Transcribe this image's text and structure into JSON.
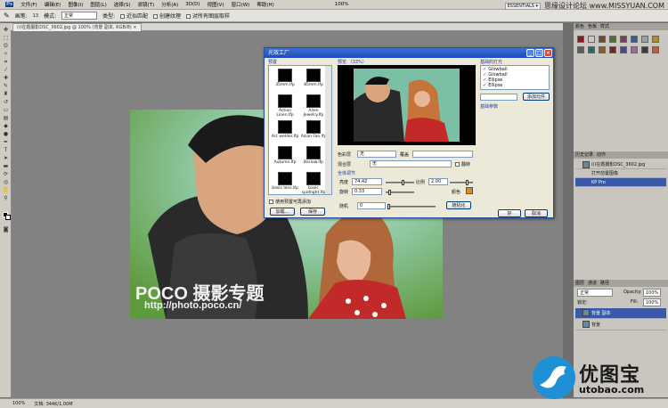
{
  "app": {
    "menu": [
      "文件(F)",
      "编辑(E)",
      "图像(I)",
      "图层(L)",
      "选择(S)",
      "滤镜(T)",
      "分析(A)",
      "3D(D)",
      "视图(V)",
      "窗口(W)",
      "帮助(H)"
    ],
    "zoom": "100%",
    "workspace": "ESSENTIALS ▾",
    "brand": "思缘设计论坛 www.MISSYUAN.COM"
  },
  "options": {
    "brush_label": "画笔:",
    "brush_size": "13",
    "mode_label": "模式:",
    "mode_value": "正常",
    "type_label": "类型:",
    "opt1": "近似匹配",
    "opt2": "创建纹理",
    "opt3": "对所有图层取样"
  },
  "document": {
    "tab_title": "(i)在婚摄影DSC_3602.jpg @ 100% (背景 副本, RGB/8) ×",
    "watermark_main": "POCO 摄影专题",
    "watermark_url": "http://photo.poco.cn/"
  },
  "status": {
    "zoom": "100%",
    "doc": "文档: 344K/1.00M"
  },
  "dialog": {
    "title": "光效工厂",
    "presets_label": "预置",
    "preview_label": "预览 （33%）",
    "elements_label": "基础的灯光",
    "presets": [
      [
        "35mm.lfp",
        "85mm.lfp"
      ],
      [
        "Action Linen.lfp",
        "Alien Jewelry.lfp"
      ],
      [
        "Arc welder.lfp",
        "Asian Fan.lfp"
      ],
      [
        "Autumn.lfp",
        "Barlow.lfp"
      ],
      [
        "basic lens.lfp",
        "basic spotlight.lfp"
      ]
    ],
    "preset_checkbox": "使用预置可再添加",
    "load_btn": "加载...",
    "save_btn": "保存",
    "color_mode_label": "色彩层",
    "color_mode_value": "无",
    "overlay_label": "覆盖",
    "blend_label": "混合层",
    "blend_value": "无",
    "flip_label": "翻转",
    "global_label": "全体调节",
    "brightness_label": "亮度",
    "brightness_value": "74.42",
    "scale_label": "比例",
    "scale_value": "2.00",
    "rotation_label": "旋转",
    "rotation_value": "0.33",
    "color_label": "颜色",
    "random_label": "随机",
    "random_value": "0",
    "random_btn": "随机化",
    "elements": [
      "Glowball",
      "Glowball",
      "Ellipse",
      "Ellipse"
    ],
    "add_elem_btn": "添加元件",
    "elem_params_label": "基础参数",
    "ok_btn": "好",
    "cancel_btn": "取消"
  },
  "panels": {
    "tabs": [
      "颜色",
      "色板",
      "样式"
    ],
    "history_tabs": [
      "历史记录",
      "动作"
    ],
    "history_items": [
      "(i)在婚摄影DSC_3602.jpg",
      "打开前置图像",
      "KP Pro"
    ],
    "layer_tabs": [
      "图层",
      "通道",
      "路径"
    ],
    "blend_mode": "正常",
    "opacity_label": "Opacity:",
    "opacity_value": "100%",
    "lock_label": "锁定:",
    "fill_label": "Fill:",
    "fill_value": "100%",
    "layers": [
      "背景 副本",
      "背景"
    ]
  },
  "watermark": {
    "site_name": "优图宝",
    "site_url": "utobao.com"
  },
  "colors": {
    "accent": "#2b4f9c",
    "swatches": [
      "#8a1c1c",
      "#c9c9c9",
      "#6b4a2b",
      "#4f6f2f",
      "#7a3a6a",
      "#3a5a8a",
      "#a0a0a0",
      "#b58a2a",
      "#5a5a5a",
      "#2a6a6a",
      "#8a5a2a",
      "#6a2a2a",
      "#4a4a8a",
      "#9a6a9a",
      "#3a3a3a",
      "#c06030"
    ]
  }
}
